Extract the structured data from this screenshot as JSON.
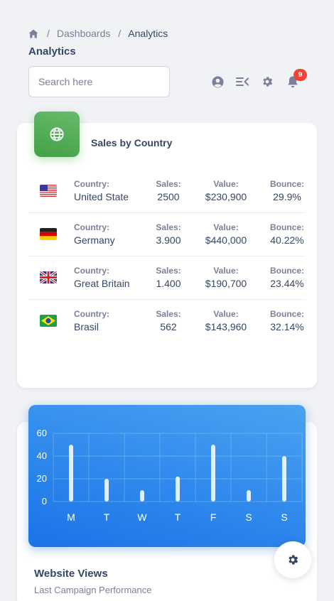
{
  "breadcrumb": {
    "items": [
      "Dashboards",
      "Analytics"
    ],
    "separator": "/"
  },
  "page": {
    "title": "Analytics"
  },
  "search": {
    "placeholder": "Search here"
  },
  "topbar": {
    "icons": [
      "user-circle-icon",
      "menu-open-icon",
      "gear-icon",
      "bell-icon"
    ],
    "notifications": "9"
  },
  "sales_card": {
    "title": "Sales by Country",
    "icon": "globe-icon",
    "labels": {
      "country": "Country:",
      "sales": "Sales:",
      "value": "Value:",
      "bounce": "Bounce:"
    },
    "rows": [
      {
        "flag": "us-flag-icon",
        "country": "United State",
        "sales": "2500",
        "value": "$230,900",
        "bounce": "29.9%"
      },
      {
        "flag": "de-flag-icon",
        "country": "Germany",
        "sales": "3.900",
        "value": "$440,000",
        "bounce": "40.22%"
      },
      {
        "flag": "gb-flag-icon",
        "country": "Great Britain",
        "sales": "1.400",
        "value": "$190,700",
        "bounce": "23.44%"
      },
      {
        "flag": "br-flag-icon",
        "country": "Brasil",
        "sales": "562",
        "value": "$143,960",
        "bounce": "32.14%"
      }
    ]
  },
  "views_card": {
    "title": "Website Views",
    "subtitle": "Last Campaign Performance"
  },
  "chart_data": {
    "type": "bar",
    "categories": [
      "M",
      "T",
      "W",
      "T",
      "F",
      "S",
      "S"
    ],
    "values": [
      50,
      20,
      10,
      22,
      50,
      10,
      40
    ],
    "ylim": [
      0,
      60
    ],
    "yticks": [
      60,
      40,
      20,
      0
    ],
    "title": "",
    "xlabel": "",
    "ylabel": "",
    "grid": true,
    "colors": {
      "bar": "#ffffff",
      "grid": "#ffffff",
      "background_from": "#49a3f1",
      "background_to": "#1a73e8"
    }
  },
  "colors": {
    "brand_green": "#4caf50",
    "brand_blue": "#1a73e8",
    "badge_red": "#f44335",
    "text_dark": "#344767",
    "text_muted": "#7b809a"
  }
}
